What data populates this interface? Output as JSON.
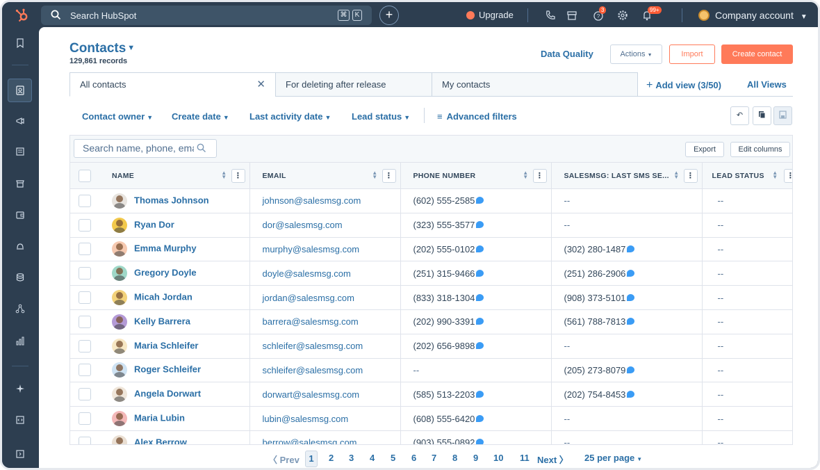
{
  "topbar": {
    "search_placeholder": "Search HubSpot",
    "kbd_cmd": "⌘",
    "kbd_k": "K",
    "upgrade_label": "Upgrade",
    "help_badge": "3",
    "notif_badge": "99+",
    "account_label": "Company account"
  },
  "header": {
    "title": "Contacts",
    "records": "129,861 records",
    "data_quality": "Data Quality",
    "actions_label": "Actions",
    "import_label": "Import",
    "create_label": "Create contact"
  },
  "views": {
    "tabs": [
      "All contacts",
      "For deleting after release",
      "My contacts"
    ],
    "add_view": "Add view (3/50)",
    "all_views": "All Views"
  },
  "filters": {
    "items": [
      "Contact owner",
      "Create date",
      "Last activity date",
      "Lead status"
    ],
    "advanced": "Advanced filters"
  },
  "table": {
    "search_placeholder": "Search name, phone, email",
    "export_label": "Export",
    "edit_columns_label": "Edit columns",
    "columns": [
      "NAME",
      "EMAIL",
      "PHONE NUMBER",
      "SALESMSG: LAST SMS SE...",
      "LEAD STATUS"
    ],
    "rows": [
      {
        "name": "Thomas Johnson",
        "email": "johnson@salesmsg.com",
        "phone": "(602) 555-2585",
        "sms": "--",
        "lead": "--",
        "avatar": "#e8e4df"
      },
      {
        "name": "Ryan Dor",
        "email": "dor@salesmsg.com",
        "phone": "(323) 555-3577",
        "sms": "--",
        "lead": "--",
        "avatar": "#f2c94c"
      },
      {
        "name": "Emma Murphy",
        "email": "murphy@salesmsg.com",
        "phone": "(202) 555-0102",
        "sms": "(302) 280-1487",
        "lead": "--",
        "avatar": "#f6c9b0"
      },
      {
        "name": "Gregory Doyle",
        "email": "doyle@salesmsg.com",
        "phone": "(251) 315-9466",
        "sms": "(251) 286-2906",
        "lead": "--",
        "avatar": "#9fd8c8"
      },
      {
        "name": "Micah Jordan",
        "email": "jordan@salesmsg.com",
        "phone": "(833) 318-1304",
        "sms": "(908) 373-5101",
        "lead": "--",
        "avatar": "#f3d27a"
      },
      {
        "name": "Kelly Barrera",
        "email": "barrera@salesmsg.com",
        "phone": "(202) 990-3391",
        "sms": "(561) 788-7813",
        "lead": "--",
        "avatar": "#b49ad6"
      },
      {
        "name": "Maria Schleifer",
        "email": "schleifer@salesmsg.com",
        "phone": "(202) 656-9898",
        "sms": "--",
        "lead": "--",
        "avatar": "#f7e7c4"
      },
      {
        "name": "Roger Schleifer",
        "email": "schleifer@salesmsg.com",
        "phone": "--",
        "sms": "(205) 273-8079",
        "lead": "--",
        "avatar": "#cfe3f3"
      },
      {
        "name": "Angela Dorwart",
        "email": "dorwart@salesmsg.com",
        "phone": "(585) 513-2203",
        "sms": "(202) 754-8453",
        "lead": "--",
        "avatar": "#efe6da"
      },
      {
        "name": "Maria Lubin",
        "email": "lubin@salesmsg.com",
        "phone": "(608) 555-6420",
        "sms": "--",
        "lead": "--",
        "avatar": "#f4b8b8"
      },
      {
        "name": "Alex Berrow",
        "email": "berrow@salesmsg.com",
        "phone": "(903) 555-0892",
        "sms": "--",
        "lead": "--",
        "avatar": "#eadfd3"
      }
    ]
  },
  "pagination": {
    "prev": "Prev",
    "pages": [
      "1",
      "2",
      "3",
      "4",
      "5",
      "6",
      "7",
      "8",
      "9",
      "10",
      "11"
    ],
    "current": "1",
    "next": "Next",
    "per_page": "25 per page"
  },
  "colors": {
    "nav_bg": "#2d3e50",
    "link": "#2b6fa6",
    "accent": "#ff7a59",
    "sms_icon": "#3b9cf5"
  }
}
